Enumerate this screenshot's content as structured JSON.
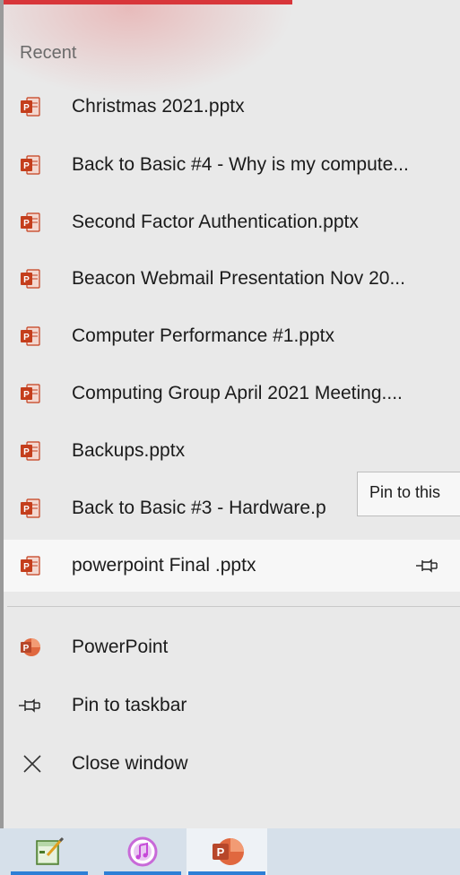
{
  "jumplist": {
    "section_title": "Recent",
    "recent_items": [
      {
        "label": "Christmas 2021.pptx"
      },
      {
        "label": "Back to Basic #4 - Why is my compute..."
      },
      {
        "label": "Second Factor Authentication.pptx"
      },
      {
        "label": "Beacon Webmail Presentation Nov 20..."
      },
      {
        "label": "Computer Performance #1.pptx"
      },
      {
        "label": "Computing Group April 2021 Meeting...."
      },
      {
        "label": "Backups.pptx"
      },
      {
        "label": "Back to Basic #3 - Hardware.p"
      },
      {
        "label": "powerpoint Final .pptx"
      }
    ],
    "tooltip": "Pin to this",
    "tasks": [
      {
        "label": "PowerPoint",
        "icon": "powerpoint-app-icon"
      },
      {
        "label": "Pin to taskbar",
        "icon": "pin-icon"
      },
      {
        "label": "Close window",
        "icon": "close-icon"
      }
    ]
  },
  "taskbar": {
    "apps": [
      {
        "name": "notepad-icon"
      },
      {
        "name": "itunes-icon"
      },
      {
        "name": "powerpoint-taskbar-icon",
        "active": true
      }
    ]
  },
  "colors": {
    "accent_red": "#d8363a",
    "powerpoint_orange": "#c43e1c",
    "taskbar_indicator": "#2d7fd6"
  }
}
